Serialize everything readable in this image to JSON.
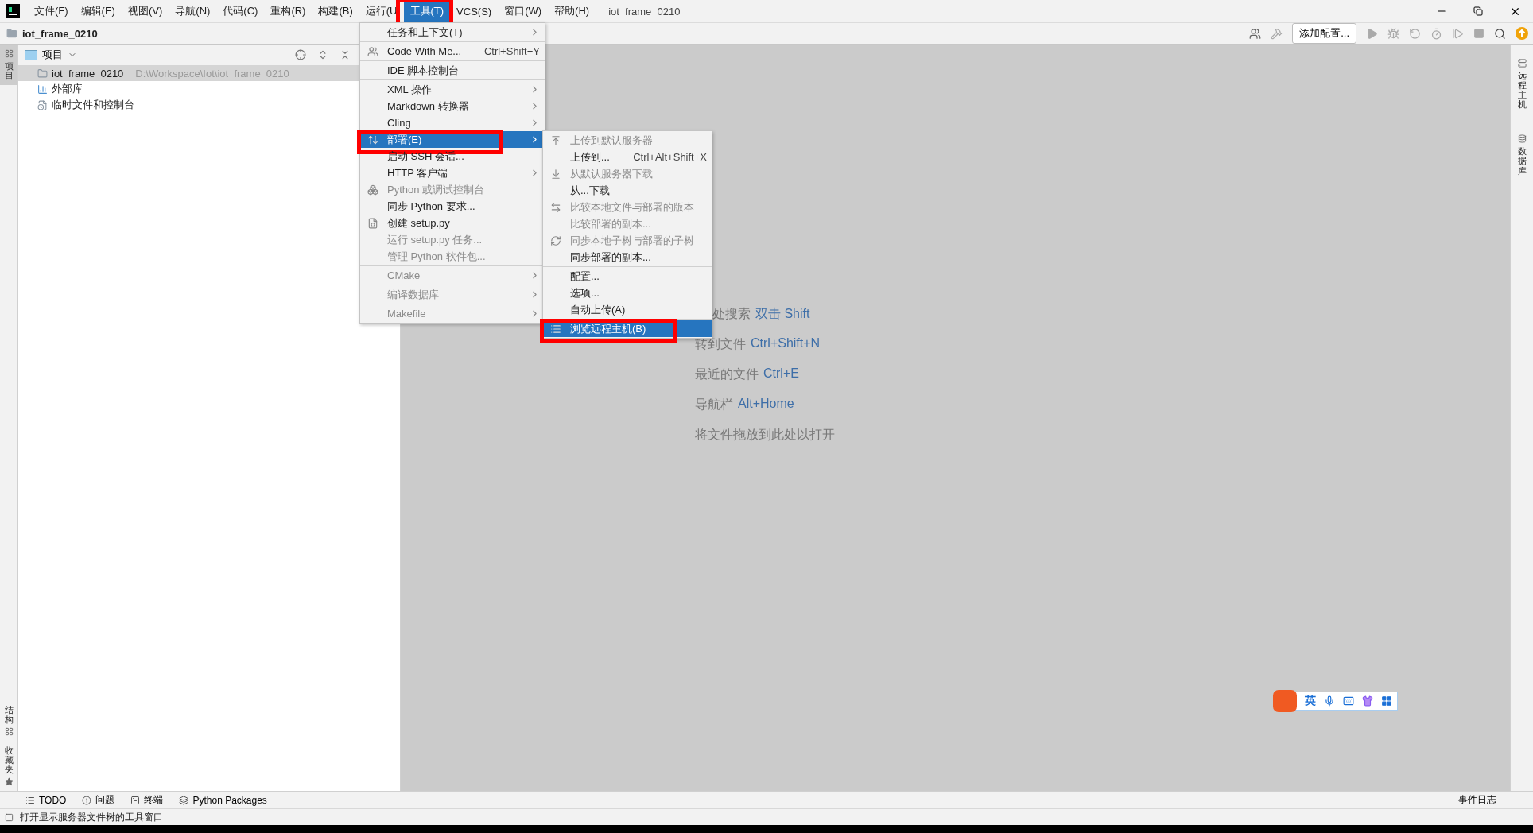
{
  "menu_bar": [
    {
      "label": "文件(F)",
      "selected": false,
      "highlighted": false
    },
    {
      "label": "编辑(E)",
      "selected": false,
      "highlighted": false
    },
    {
      "label": "视图(V)",
      "selected": false,
      "highlighted": false
    },
    {
      "label": "导航(N)",
      "selected": false,
      "highlighted": false
    },
    {
      "label": "代码(C)",
      "selected": false,
      "highlighted": false
    },
    {
      "label": "重构(R)",
      "selected": false,
      "highlighted": false
    },
    {
      "label": "构建(B)",
      "selected": false,
      "highlighted": false
    },
    {
      "label": "运行(U",
      "selected": false,
      "highlighted": false
    },
    {
      "label": "工具(T)",
      "selected": true,
      "highlighted": true
    },
    {
      "label": "VCS(S)",
      "selected": false,
      "highlighted": false
    },
    {
      "label": "窗口(W)",
      "selected": false,
      "highlighted": false
    },
    {
      "label": "帮助(H)",
      "selected": false,
      "highlighted": false
    }
  ],
  "window": {
    "title": "iot_frame_0210"
  },
  "project_bar": {
    "name": "iot_frame_0210"
  },
  "toolbar": {
    "config_button": "添加配置..."
  },
  "left_strip": [
    {
      "label": "项目",
      "selected": true
    },
    {
      "label": "结构",
      "selected": false
    },
    {
      "label": "收藏夹",
      "selected": false
    }
  ],
  "right_strip": [
    {
      "label": "远程主机"
    },
    {
      "label": "数据库"
    }
  ],
  "project_panel": {
    "view": "项目",
    "tree": [
      {
        "label": "iot_frame_0210",
        "path": "D:\\Workspace\\Iot\\iot_frame_0210",
        "selected": true
      },
      {
        "label": "外部库",
        "selected": false
      },
      {
        "label": "临时文件和控制台",
        "selected": false
      }
    ]
  },
  "editor_hints": [
    {
      "label": "处搜索",
      "key": "双击 Shift"
    },
    {
      "label": "转到文件",
      "key": "Ctrl+Shift+N"
    },
    {
      "label": "最近的文件",
      "key": "Ctrl+E"
    },
    {
      "label": "导航栏",
      "key": "Alt+Home"
    },
    {
      "label": "将文件拖放到此处以打开"
    }
  ],
  "tools_menu": [
    {
      "kind": "item",
      "label": "任务和上下文(T)",
      "submenu": true,
      "disabled": false,
      "selected": false,
      "highlighted": false
    },
    {
      "kind": "separator"
    },
    {
      "kind": "item",
      "label": "Code With Me...",
      "shortcut": "Ctrl+Shift+Y",
      "disabled": false,
      "selected": false,
      "highlighted": false
    },
    {
      "kind": "separator"
    },
    {
      "kind": "item",
      "label": "IDE 脚本控制台",
      "disabled": false,
      "selected": false,
      "highlighted": false
    },
    {
      "kind": "separator"
    },
    {
      "kind": "item",
      "label": "XML 操作",
      "submenu": true,
      "disabled": false,
      "selected": false,
      "highlighted": false
    },
    {
      "kind": "item",
      "label": "Markdown 转换器",
      "submenu": true,
      "disabled": false,
      "selected": false,
      "highlighted": false
    },
    {
      "kind": "item",
      "label": "Cling",
      "submenu": true,
      "disabled": false,
      "selected": false,
      "highlighted": false
    },
    {
      "kind": "item",
      "label": "部署(E)",
      "submenu": true,
      "disabled": false,
      "selected": true,
      "highlighted": true
    },
    {
      "kind": "item",
      "label": "启动 SSH 会话...",
      "disabled": false,
      "selected": false,
      "highlighted": false
    },
    {
      "kind": "item",
      "label": "HTTP 客户端",
      "submenu": true,
      "disabled": false,
      "selected": false,
      "highlighted": false
    },
    {
      "kind": "item",
      "label": "Python 或调试控制台",
      "disabled": true,
      "selected": false,
      "highlighted": false
    },
    {
      "kind": "item",
      "label": "同步 Python 要求...",
      "disabled": false,
      "selected": false,
      "highlighted": false
    },
    {
      "kind": "item",
      "label": "创建 setup.py",
      "disabled": false,
      "selected": false,
      "highlighted": false
    },
    {
      "kind": "item",
      "label": "运行 setup.py 任务...",
      "disabled": true,
      "selected": false,
      "highlighted": false
    },
    {
      "kind": "item",
      "label": "管理 Python 软件包...",
      "disabled": true,
      "selected": false,
      "highlighted": false
    },
    {
      "kind": "separator"
    },
    {
      "kind": "item",
      "label": "CMake",
      "submenu": true,
      "disabled": true,
      "selected": false,
      "highlighted": false
    },
    {
      "kind": "separator"
    },
    {
      "kind": "item",
      "label": "编译数据库",
      "submenu": true,
      "disabled": true,
      "selected": false,
      "highlighted": false
    },
    {
      "kind": "separator"
    },
    {
      "kind": "item",
      "label": "Makefile",
      "submenu": true,
      "disabled": true,
      "selected": false,
      "highlighted": false
    }
  ],
  "deploy_submenu": [
    {
      "kind": "item",
      "label": "上传到默认服务器",
      "disabled": true,
      "selected": false,
      "highlighted": false
    },
    {
      "kind": "item",
      "label": "上传到...",
      "shortcut": "Ctrl+Alt+Shift+X",
      "disabled": false,
      "selected": false,
      "highlighted": false
    },
    {
      "kind": "item",
      "label": "从默认服务器下载",
      "disabled": true,
      "selected": false,
      "highlighted": false
    },
    {
      "kind": "item",
      "label": "从...下载",
      "disabled": false,
      "selected": false,
      "highlighted": false
    },
    {
      "kind": "item",
      "label": "比较本地文件与部署的版本",
      "disabled": true,
      "selected": false,
      "highlighted": false
    },
    {
      "kind": "item",
      "label": "比较部署的副本...",
      "disabled": true,
      "selected": false,
      "highlighted": false
    },
    {
      "kind": "item",
      "label": "同步本地子树与部署的子树",
      "disabled": true,
      "selected": false,
      "highlighted": false
    },
    {
      "kind": "item",
      "label": "同步部署的副本...",
      "disabled": false,
      "selected": false,
      "highlighted": false
    },
    {
      "kind": "separator"
    },
    {
      "kind": "item",
      "label": "配置...",
      "disabled": false,
      "selected": false,
      "highlighted": false
    },
    {
      "kind": "item",
      "label": "选项...",
      "disabled": false,
      "selected": false,
      "highlighted": false
    },
    {
      "kind": "item",
      "label": "自动上传(A)",
      "disabled": false,
      "selected": false,
      "highlighted": false
    },
    {
      "kind": "separator"
    },
    {
      "kind": "item",
      "label": "浏览远程主机(B)",
      "disabled": false,
      "selected": true,
      "highlighted": true
    }
  ],
  "ime_toolbar": {
    "mode": "英"
  },
  "bottom_tabs": [
    {
      "label": "TODO"
    },
    {
      "label": "问题"
    },
    {
      "label": "终端"
    },
    {
      "label": "Python Packages"
    }
  ],
  "event_log": "事件日志",
  "status_bar": {
    "message": "打开显示服务器文件树的工具窗口"
  }
}
